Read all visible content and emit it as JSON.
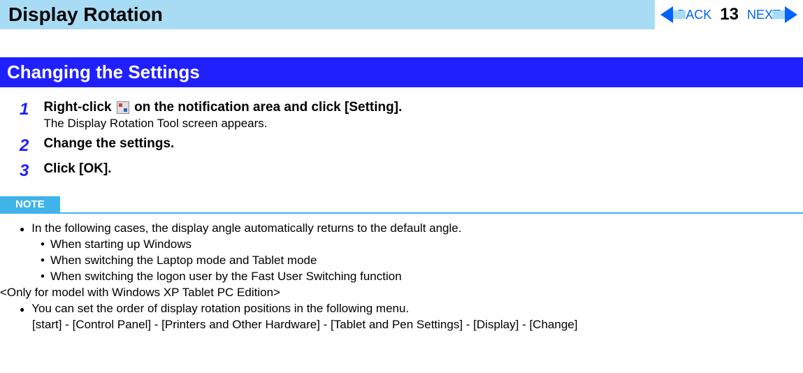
{
  "header": {
    "title": "Display Rotation",
    "back_label": "BACK",
    "next_label": "NEXT",
    "page_number": "13"
  },
  "section": {
    "title": "Changing the Settings"
  },
  "steps": [
    {
      "num": "1",
      "title_before": "Right-click ",
      "title_after": " on the notification area and click [Setting].",
      "desc": "The Display Rotation Tool screen appears."
    },
    {
      "num": "2",
      "title": "Change the settings."
    },
    {
      "num": "3",
      "title": "Click [OK]."
    }
  ],
  "note": {
    "label": "NOTE",
    "bullet1": "In the following cases, the display angle automatically returns to the default angle.",
    "sub1": "When starting up Windows",
    "sub2": "When switching the Laptop mode and Tablet mode",
    "sub3": "When switching the logon user by the Fast User Switching function",
    "line1": "<Only for model with Windows XP Tablet PC Edition>",
    "bullet2": "You can set the order of display rotation positions in the following menu.",
    "line2": "[start] - [Control Panel] - [Printers and Other Hardware] - [Tablet and Pen Settings] - [Display] - [Change]"
  }
}
